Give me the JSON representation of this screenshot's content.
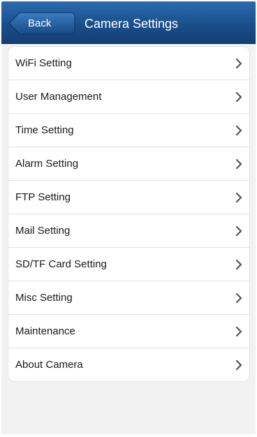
{
  "nav": {
    "back_label": "Back",
    "title": "Camera Settings"
  },
  "menu": {
    "items": [
      {
        "label": "WiFi Setting",
        "icon": "chevron-right-icon"
      },
      {
        "label": "User Management",
        "icon": "chevron-right-icon"
      },
      {
        "label": "Time Setting",
        "icon": "chevron-right-icon"
      },
      {
        "label": "Alarm Setting",
        "icon": "chevron-right-icon"
      },
      {
        "label": "FTP Setting",
        "icon": "chevron-right-icon"
      },
      {
        "label": "Mail Setting",
        "icon": "chevron-right-icon"
      },
      {
        "label": "SD/TF Card Setting",
        "icon": "chevron-right-icon"
      },
      {
        "label": "Misc Setting",
        "icon": "chevron-right-icon"
      },
      {
        "label": "Maintenance",
        "icon": "chevron-right-icon"
      },
      {
        "label": "About Camera",
        "icon": "chevron-right-icon"
      }
    ]
  },
  "colors": {
    "navbar": "#1a4f8c",
    "background": "#f2f2f2",
    "chevron": "#555555"
  }
}
